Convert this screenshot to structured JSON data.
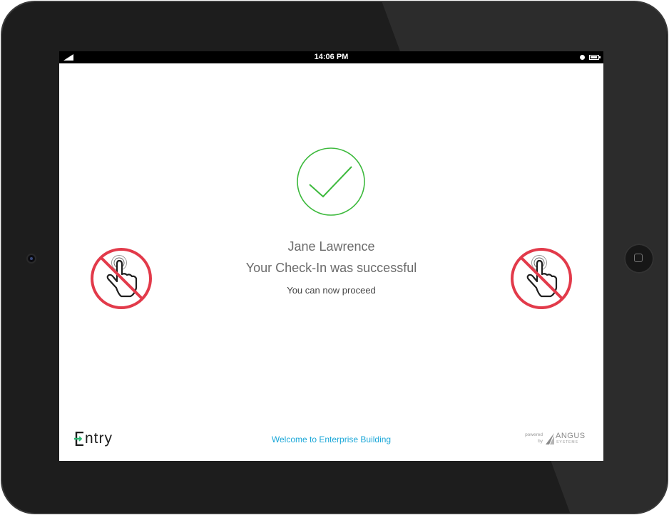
{
  "status_bar": {
    "time": "14:06 PM"
  },
  "checkin": {
    "visitor_name": "Jane Lawrence",
    "message": "Your Check-In was successful",
    "instruction": "You can now proceed"
  },
  "footer": {
    "logo_text": "ntry",
    "welcome_text": "Welcome to Enterprise Building",
    "powered_by": "powered by",
    "vendor_name": "ANGUS",
    "vendor_sub": "SYSTEMS"
  },
  "icons": [
    "signal-icon",
    "clock-icon",
    "battery-icon",
    "checkmark-circle-icon",
    "no-touch-icon",
    "entry-logo-icon",
    "angus-logo-icon"
  ],
  "colors": {
    "success_green": "#3cb93c",
    "prohibit_red": "#e23a4a",
    "welcome_blue": "#1aa7d8",
    "logo_green": "#2bb673"
  }
}
